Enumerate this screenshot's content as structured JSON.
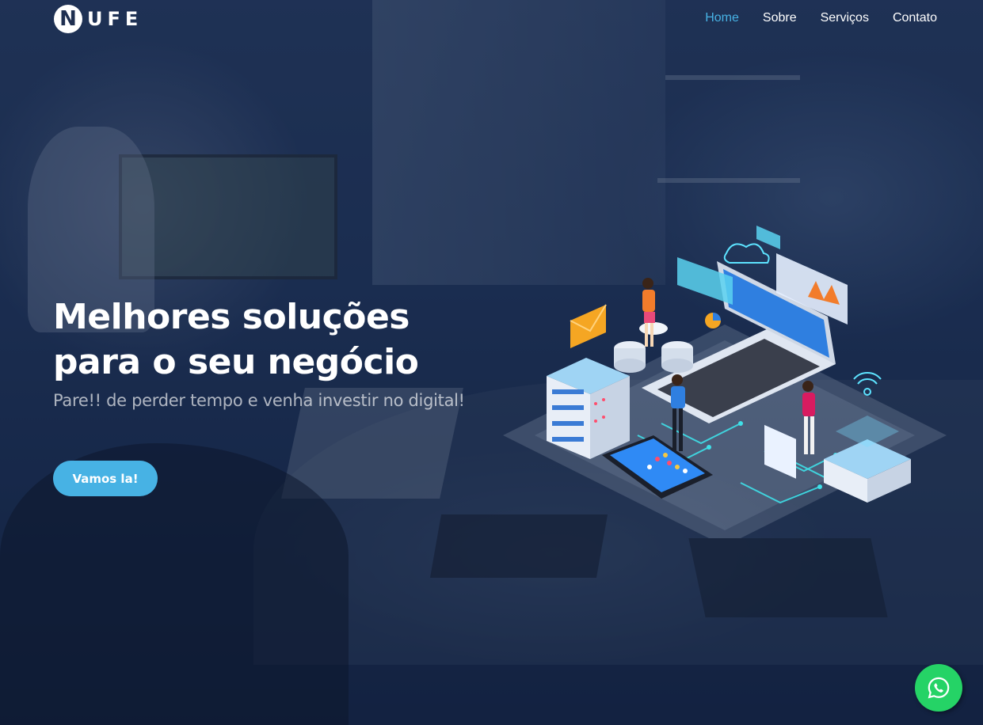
{
  "brand": {
    "logo_text": "UFE",
    "logo_letter": "N"
  },
  "nav": {
    "items": [
      {
        "label": "Home",
        "active": true
      },
      {
        "label": "Sobre",
        "active": false
      },
      {
        "label": "Serviços",
        "active": false
      },
      {
        "label": "Contato",
        "active": false
      }
    ]
  },
  "hero": {
    "title": "Melhores soluções para o seu negócio",
    "subtitle": "Pare!! de perder tempo e venha investir no digital!",
    "cta_label": "Vamos la!"
  },
  "icons": {
    "whatsapp": "whatsapp-icon"
  },
  "colors": {
    "accent": "#47b2e4",
    "whatsapp": "#25d366",
    "text": "#ffffff"
  }
}
